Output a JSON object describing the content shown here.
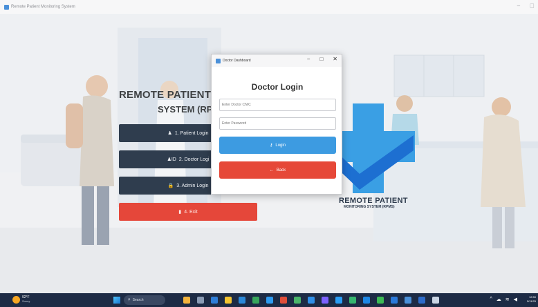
{
  "main_window": {
    "title": "Remote Patient Monitoring System",
    "controls": {
      "minimize": "−",
      "maximize": "□"
    }
  },
  "hero": {
    "title": "REMOTE PATIENT MC",
    "subtitle": "SYSTEM (RPM"
  },
  "menu": [
    {
      "icon": "person-icon",
      "label": "1. Patient Login"
    },
    {
      "icon": "id-card-icon",
      "label": "2. Doctor Logi"
    },
    {
      "icon": "lock-icon",
      "label": "3. Admin Login"
    },
    {
      "icon": "exit-door-icon",
      "label": "4. Exit"
    }
  ],
  "logo": {
    "title": "REMOTE PATIENT",
    "subtitle": "MONITORING SYSTEM (RPMS)"
  },
  "dialog": {
    "title": "Doctor Dashboard",
    "controls": {
      "minimize": "−",
      "maximize": "□",
      "close": "✕"
    },
    "heading": "Doctor Login",
    "cnic_placeholder": "Enter Doctor CNIC",
    "password_placeholder": "Enter Password",
    "login_label": "Login",
    "back_label": "Back"
  },
  "taskbar": {
    "weather_temp": "92°F",
    "weather_desc": "Sunny",
    "search_label": "Search",
    "clock_time": "12:50",
    "clock_date": "5/11/25"
  },
  "colors": {
    "menu_button": "#2f3d4e",
    "exit_button": "#e5473a",
    "login_button": "#3d9be1",
    "back_button": "#e64838",
    "taskbar": "#1d2b45"
  }
}
